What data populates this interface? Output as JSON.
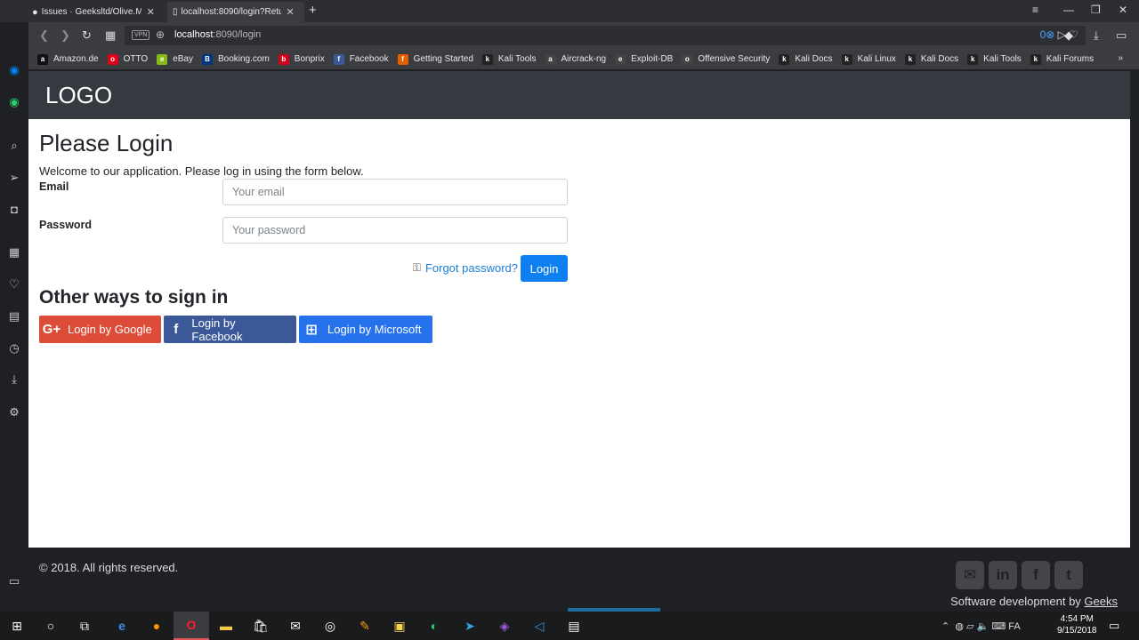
{
  "browser": {
    "tabs": [
      {
        "title": "Issues · Geeksltd/Olive.Mv"
      },
      {
        "title": "localhost:8090/login?Retu"
      }
    ],
    "url": "localhost:8090/login",
    "url_host": "localhost",
    "url_path": ":8090/login",
    "vpn_label": "VPN",
    "bookmarks": [
      {
        "label": "Amazon.de",
        "icon": "a",
        "color": "#111"
      },
      {
        "label": "OTTO",
        "icon": "otto",
        "color": "#e2001a"
      },
      {
        "label": "eBay",
        "icon": "e",
        "color": "#86b817"
      },
      {
        "label": "Booking.com",
        "icon": "B.",
        "color": "#003580"
      },
      {
        "label": "Bonprix",
        "icon": "bp",
        "color": "#d4001a"
      },
      {
        "label": "Facebook",
        "icon": "f",
        "color": "#3b5998"
      },
      {
        "label": "Getting Started",
        "icon": "ff",
        "color": "#e66000"
      },
      {
        "label": "Kali Tools",
        "icon": "k",
        "color": "#222"
      },
      {
        "label": "Aircrack-ng",
        "icon": "ac",
        "color": "#444"
      },
      {
        "label": "Exploit-DB",
        "icon": "ex",
        "color": "#444"
      },
      {
        "label": "Offensive Security",
        "icon": "os",
        "color": "#444"
      },
      {
        "label": "Kali Docs",
        "icon": "k",
        "color": "#222"
      },
      {
        "label": "Kali Linux",
        "icon": "k",
        "color": "#222"
      },
      {
        "label": "Kali Docs",
        "icon": "k",
        "color": "#222"
      },
      {
        "label": "Kali Tools",
        "icon": "k",
        "color": "#222"
      },
      {
        "label": "Kali Forums",
        "icon": "k",
        "color": "#222"
      }
    ],
    "bookmarks_more": "»"
  },
  "site": {
    "logo": "LOGO",
    "title": "Please Login",
    "welcome": "Welcome to our application. Please log in using the form below.",
    "email_label": "Email",
    "email_placeholder": "Your email",
    "password_label": "Password",
    "password_placeholder": "Your password",
    "forgot_label": "Forgot password?",
    "login_label": "Login",
    "other_title": "Other ways to sign in",
    "social": {
      "google": "Login by Google",
      "facebook": "Login by Facebook",
      "microsoft": "Login by Microsoft"
    },
    "footer": {
      "copyright": "© 2018. All rights reserved.",
      "credit_prefix": "Software development by ",
      "credit_link": "Geeks"
    }
  },
  "taskbar": {
    "time": "4:54 PM",
    "date": "9/15/2018",
    "lang": "FA"
  },
  "colors": {
    "header": "#343a40",
    "primary": "#0d7ff0",
    "google": "#dd4b39",
    "facebook": "#3b5998",
    "microsoft": "#2672ec"
  }
}
